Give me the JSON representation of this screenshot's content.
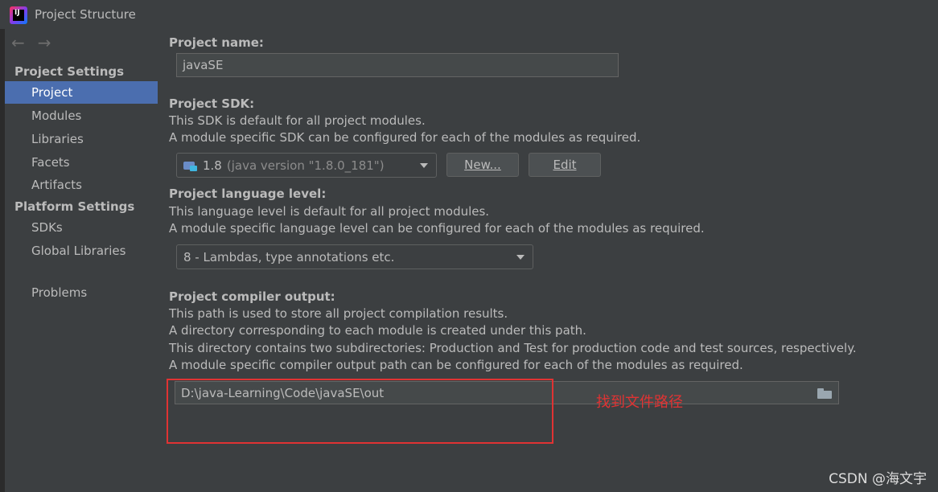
{
  "window": {
    "title": "Project Structure",
    "app_icon_text": "IJ"
  },
  "nav": {
    "back": "←",
    "forward": "→"
  },
  "sidebar": {
    "project_settings_header": "Project Settings",
    "project_settings_items": [
      "Project",
      "Modules",
      "Libraries",
      "Facets",
      "Artifacts"
    ],
    "platform_settings_header": "Platform Settings",
    "platform_settings_items": [
      "SDKs",
      "Global Libraries"
    ],
    "problems": "Problems",
    "selected": "Project"
  },
  "main": {
    "project_name": {
      "label": "Project name:",
      "value": "javaSE"
    },
    "project_sdk": {
      "label": "Project SDK:",
      "desc1": "This SDK is default for all project modules.",
      "desc2": "A module specific SDK can be configured for each of the modules as required.",
      "selected_version": "1.8",
      "selected_detail": "(java version \"1.8.0_181\")",
      "new_button": "New...",
      "edit_button": "Edit"
    },
    "language_level": {
      "label": "Project language level:",
      "desc1": "This language level is default for all project modules.",
      "desc2": "A module specific language level can be configured for each of the modules as required.",
      "selected": "8 - Lambdas, type annotations etc."
    },
    "compiler_output": {
      "label": "Project compiler output:",
      "desc1": "This path is used to store all project compilation results.",
      "desc2": "A directory corresponding to each module is created under this path.",
      "desc3": "This directory contains two subdirectories: Production and Test for production code and test sources, respectively.",
      "desc4": "A module specific compiler output path can be configured for each of the modules as required.",
      "path": "D:\\java-Learning\\Code\\javaSE\\out"
    }
  },
  "annotation": {
    "text": "找到文件路径"
  },
  "watermark": {
    "text": "CSDN @海文宇"
  },
  "colors": {
    "selection": "#4b6eaf",
    "annotation": "#e03333",
    "background": "#3c3f41"
  }
}
